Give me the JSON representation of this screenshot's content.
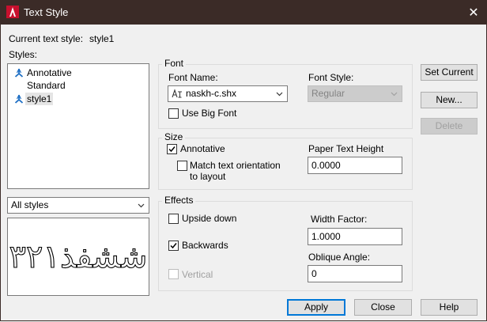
{
  "window": {
    "title": "Text Style",
    "close_glyph": "✕"
  },
  "current_style": {
    "label": "Current text style:",
    "value": "style1"
  },
  "styles": {
    "label": "Styles:",
    "items": [
      {
        "label": "Annotative",
        "icon": "annotative-icon"
      },
      {
        "label": "Standard",
        "icon": ""
      },
      {
        "label": "style1",
        "icon": "annotative-icon",
        "selected": true
      }
    ],
    "filter": "All styles"
  },
  "preview": {
    "text": "ششفذ۳۲۱"
  },
  "font": {
    "group_label": "Font",
    "font_name_label": "Font Name:",
    "font_name_value": "naskh-c.shx",
    "font_style_label": "Font Style:",
    "font_style_value": "Regular",
    "use_big_font": "Use Big Font",
    "use_big_font_checked": false
  },
  "size": {
    "group_label": "Size",
    "annotative": "Annotative",
    "annotative_checked": true,
    "match_orientation_line1": "Match text orientation",
    "match_orientation_line2": "to layout",
    "match_orientation_checked": false,
    "paper_height_label": "Paper Text Height",
    "paper_height_value": "0.0000"
  },
  "effects": {
    "group_label": "Effects",
    "upside_down": "Upside down",
    "upside_down_checked": false,
    "backwards": "Backwards",
    "backwards_checked": true,
    "vertical": "Vertical",
    "vertical_checked": false,
    "width_factor_label": "Width Factor:",
    "width_factor_value": "1.0000",
    "oblique_label": "Oblique Angle:",
    "oblique_value": "0"
  },
  "buttons": {
    "set_current": "Set Current",
    "new": "New...",
    "delete": "Delete",
    "apply": "Apply",
    "close": "Close",
    "help": "Help"
  },
  "colors": {
    "titlebar": "#3b2b27",
    "accent": "#0078d7",
    "logo_red": "#c8102e"
  }
}
